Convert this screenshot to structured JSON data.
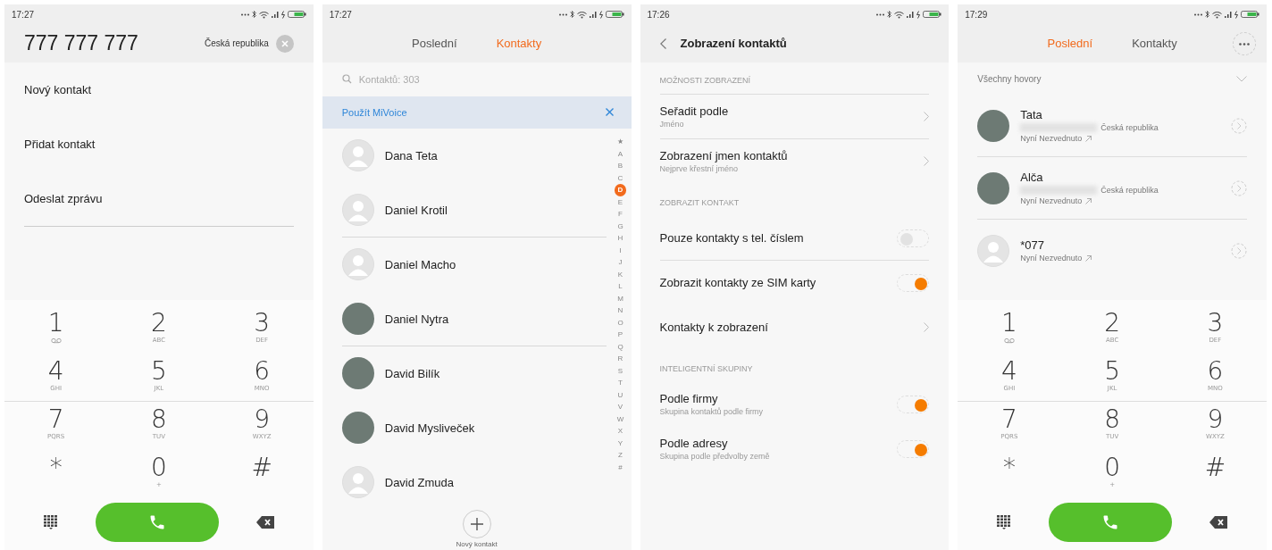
{
  "screens": [
    {
      "kind": "dialer",
      "status_bar": {
        "time": "17:27"
      },
      "number": "777 777 777",
      "country": "Česká republika",
      "actions": [
        {
          "label": "Nový kontakt"
        },
        {
          "label": "Přidat kontakt"
        },
        {
          "label": "Odeslat zprávu"
        }
      ],
      "dialpad": [
        {
          "digit": "1",
          "kind": "voicemail"
        },
        {
          "digit": "2",
          "letters": "ABC"
        },
        {
          "digit": "3",
          "letters": "DEF"
        },
        {
          "digit": "4",
          "letters": "GHI"
        },
        {
          "digit": "5",
          "letters": "JKL"
        },
        {
          "digit": "6",
          "letters": "MNO"
        },
        {
          "digit": "7",
          "letters": "PQRS"
        },
        {
          "digit": "8",
          "letters": "TUV"
        },
        {
          "digit": "9",
          "letters": "WXYZ"
        },
        {
          "digit": "*"
        },
        {
          "digit": "0",
          "letters": "+"
        },
        {
          "digit": "#"
        }
      ]
    },
    {
      "kind": "contacts",
      "status_bar": {
        "time": "17:27"
      },
      "tabs": [
        {
          "label": "Poslední",
          "selected": false
        },
        {
          "label": "Kontakty",
          "selected": true
        }
      ],
      "search": {
        "placeholder": "Kontaktů: 303"
      },
      "banner": "Použít MiVoice",
      "contacts": [
        {
          "name": "Dana Teta",
          "kind": "default",
          "divider": false
        },
        {
          "name": "Daniel Krotil",
          "kind": "default",
          "divider": true
        },
        {
          "name": "Daniel Macho",
          "kind": "default",
          "divider": false
        },
        {
          "name": "Daniel Nytra",
          "kind": "photo",
          "divider": true
        },
        {
          "name": "David Bilík",
          "kind": "photo",
          "divider": false
        },
        {
          "name": "David Mysliveček",
          "kind": "photo",
          "divider": false
        },
        {
          "name": "David Zmuda",
          "kind": "default",
          "divider": false
        }
      ],
      "index": [
        {
          "label": "★",
          "selected": false
        },
        {
          "label": "A",
          "selected": false
        },
        {
          "label": "B",
          "selected": false
        },
        {
          "label": "C",
          "selected": false
        },
        {
          "label": "D",
          "selected": true
        },
        {
          "label": "E",
          "selected": false
        },
        {
          "label": "F",
          "selected": false
        },
        {
          "label": "G",
          "selected": false
        },
        {
          "label": "H",
          "selected": false
        },
        {
          "label": "I",
          "selected": false
        },
        {
          "label": "J",
          "selected": false
        },
        {
          "label": "K",
          "selected": false
        },
        {
          "label": "L",
          "selected": false
        },
        {
          "label": "M",
          "selected": false
        },
        {
          "label": "N",
          "selected": false
        },
        {
          "label": "O",
          "selected": false
        },
        {
          "label": "P",
          "selected": false
        },
        {
          "label": "Q",
          "selected": false
        },
        {
          "label": "R",
          "selected": false
        },
        {
          "label": "S",
          "selected": false
        },
        {
          "label": "T",
          "selected": false
        },
        {
          "label": "U",
          "selected": false
        },
        {
          "label": "V",
          "selected": false
        },
        {
          "label": "W",
          "selected": false
        },
        {
          "label": "X",
          "selected": false
        },
        {
          "label": "Y",
          "selected": false
        },
        {
          "label": "Z",
          "selected": false
        },
        {
          "label": "#",
          "selected": false
        }
      ],
      "new_contact": "Nový kontakt"
    },
    {
      "kind": "settings",
      "status_bar": {
        "time": "17:26"
      },
      "title": "Zobrazení kontaktů",
      "sections": [
        {
          "header": "MOŽNOSTI ZOBRAZENÍ",
          "items": [
            {
              "kind": "nav",
              "title": "Seřadit podle",
              "subtitle": "Jméno"
            },
            {
              "kind": "nav",
              "title": "Zobrazení jmen kontaktů",
              "subtitle": "Nejprve křestní jméno"
            }
          ]
        },
        {
          "header": "ZOBRAZIT KONTAKT",
          "items": [
            {
              "kind": "toggle",
              "title": "Pouze kontakty s tel. číslem",
              "on": false
            },
            {
              "kind": "toggle",
              "title": "Zobrazit kontakty ze SIM karty",
              "on": true
            },
            {
              "kind": "nav",
              "title": "Kontakty k zobrazení"
            }
          ]
        },
        {
          "header": "INTELIGENTNÍ SKUPINY",
          "items": [
            {
              "kind": "toggle",
              "title": "Podle firmy",
              "subtitle": "Skupina kontaktů podle firmy",
              "on": true
            },
            {
              "kind": "toggle",
              "title": "Podle adresy",
              "subtitle": "Skupina podle předvolby země",
              "on": true
            }
          ]
        }
      ]
    },
    {
      "kind": "recents",
      "status_bar": {
        "time": "17:29"
      },
      "tabs": [
        {
          "label": "Poslední",
          "selected": true
        },
        {
          "label": "Kontakty",
          "selected": false
        }
      ],
      "filter": "Všechny hovory",
      "calls": [
        {
          "name": "Tata",
          "kind": "photo",
          "country": "Česká republika",
          "status": "Nyní Nezvednuto"
        },
        {
          "name": "Alča",
          "kind": "photo",
          "country": "Česká republika",
          "status": "Nyní Nezvednuto"
        },
        {
          "name": "*077",
          "kind": "default",
          "status": "Nyní Nezvednuto"
        }
      ],
      "dialpad": [
        {
          "digit": "1",
          "kind": "voicemail"
        },
        {
          "digit": "2",
          "letters": "ABC"
        },
        {
          "digit": "3",
          "letters": "DEF"
        },
        {
          "digit": "4",
          "letters": "GHI"
        },
        {
          "digit": "5",
          "letters": "JKL"
        },
        {
          "digit": "6",
          "letters": "MNO"
        },
        {
          "digit": "7",
          "letters": "PQRS"
        },
        {
          "digit": "8",
          "letters": "TUV"
        },
        {
          "digit": "9",
          "letters": "WXYZ"
        },
        {
          "digit": "*"
        },
        {
          "digit": "0",
          "letters": "+"
        },
        {
          "digit": "#"
        }
      ]
    }
  ]
}
